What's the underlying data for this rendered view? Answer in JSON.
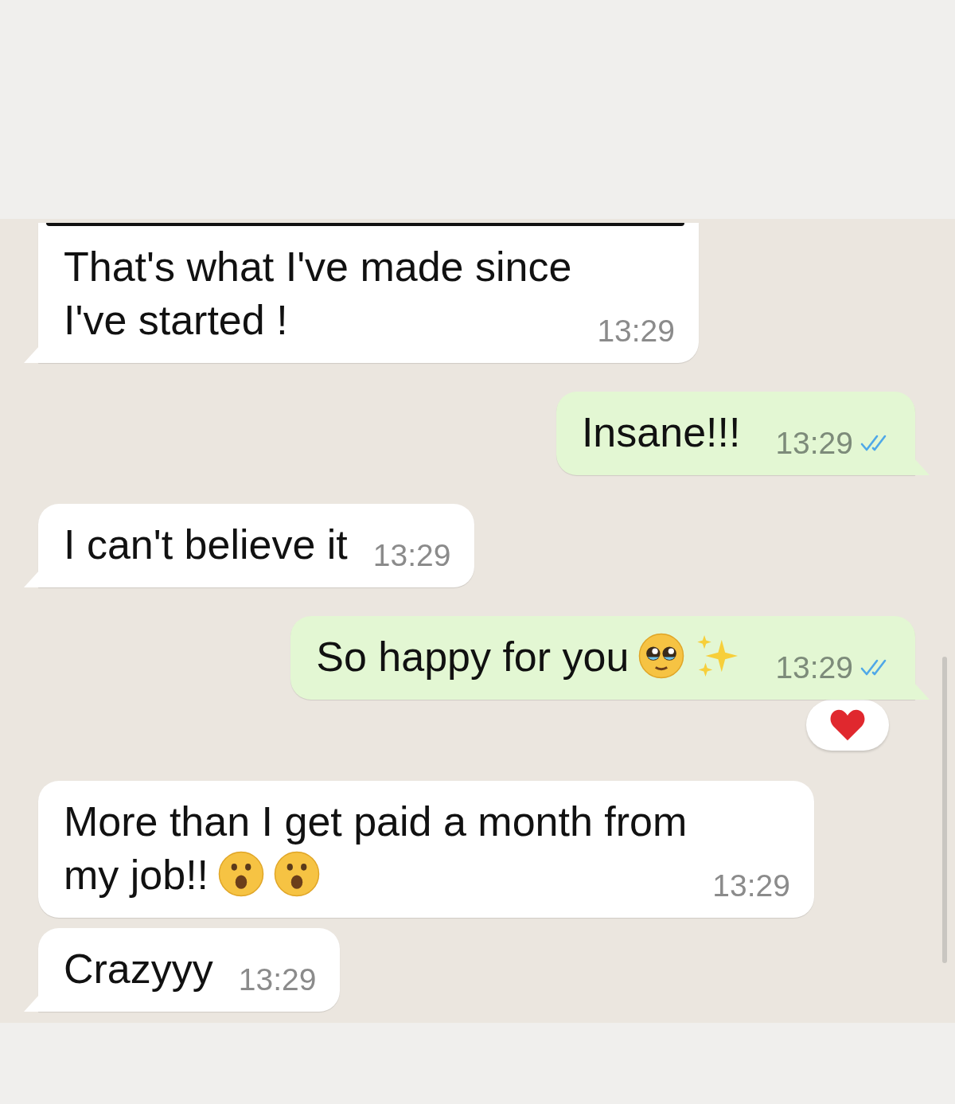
{
  "messages": [
    {
      "kind": "incoming",
      "tail": true,
      "media_above": true,
      "lines": [
        "That's what I've made since",
        "I've started !"
      ],
      "time": "13:29"
    },
    {
      "kind": "outgoing",
      "tail": true,
      "lines": [
        "Insane!!!"
      ],
      "time": "13:29",
      "read": true
    },
    {
      "kind": "incoming",
      "tail": true,
      "lines": [
        "I can't believe it"
      ],
      "time": "13:29"
    },
    {
      "kind": "outgoing",
      "tail": true,
      "lines": [
        "So happy for you"
      ],
      "emoji": [
        {
          "kind": "pleading"
        },
        {
          "kind": "sparkles"
        }
      ],
      "time": "13:29",
      "read": true,
      "reaction": {
        "kind": "heart"
      }
    },
    {
      "kind": "incoming",
      "tail": false,
      "lines": [
        "More than I get paid a month from",
        "my job!!"
      ],
      "emoji": [
        {
          "kind": "surprised"
        },
        {
          "kind": "surprised"
        }
      ],
      "time": "13:29"
    },
    {
      "kind": "incoming",
      "tail": true,
      "lines": [
        "Crazyyy"
      ],
      "time": "13:29"
    }
  ]
}
